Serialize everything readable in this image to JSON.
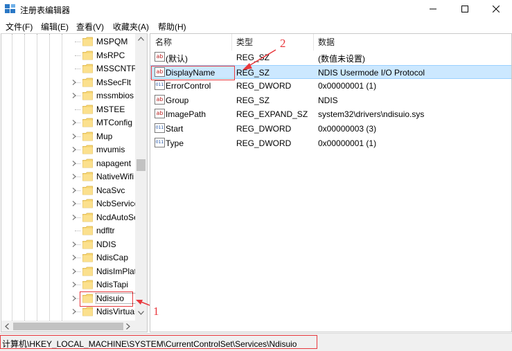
{
  "window": {
    "title": "注册表编辑器",
    "minimize_icon": "minimize-icon",
    "maximize_icon": "maximize-icon",
    "close_icon": "close-icon"
  },
  "menu": [
    "文件(F)",
    "编辑(E)",
    "查看(V)",
    "收藏夹(A)",
    "帮助(H)"
  ],
  "tree": {
    "items": [
      {
        "label": "MSPQM",
        "expandable": false
      },
      {
        "label": "MsRPC",
        "expandable": false
      },
      {
        "label": "MSSCNTRS",
        "expandable": false
      },
      {
        "label": "MsSecFlt",
        "expandable": true
      },
      {
        "label": "mssmbios",
        "expandable": true
      },
      {
        "label": "MSTEE",
        "expandable": false
      },
      {
        "label": "MTConfig",
        "expandable": true
      },
      {
        "label": "Mup",
        "expandable": true
      },
      {
        "label": "mvumis",
        "expandable": true
      },
      {
        "label": "napagent",
        "expandable": true
      },
      {
        "label": "NativeWifi",
        "expandable": true
      },
      {
        "label": "NcaSvc",
        "expandable": true
      },
      {
        "label": "NcbService",
        "expandable": true
      },
      {
        "label": "NcdAutoSetup",
        "expandable": true
      },
      {
        "label": "ndfltr",
        "expandable": false
      },
      {
        "label": "NDIS",
        "expandable": true
      },
      {
        "label": "NdisCap",
        "expandable": true
      },
      {
        "label": "NdisImPlatform",
        "expandable": true
      },
      {
        "label": "NdisTapi",
        "expandable": true
      },
      {
        "label": "Ndisuio",
        "expandable": true,
        "selected": true
      },
      {
        "label": "NdisVirtualBus",
        "expandable": true
      }
    ]
  },
  "list": {
    "columns": [
      "名称",
      "类型",
      "数据"
    ],
    "rows": [
      {
        "name": "(默认)",
        "type": "REG_SZ",
        "data": "(数值未设置)",
        "icon": "ab"
      },
      {
        "name": "DisplayName",
        "type": "REG_SZ",
        "data": "NDIS Usermode I/O Protocol",
        "icon": "ab",
        "selected": true
      },
      {
        "name": "ErrorControl",
        "type": "REG_DWORD",
        "data": "0x00000001 (1)",
        "icon": "dword"
      },
      {
        "name": "Group",
        "type": "REG_SZ",
        "data": "NDIS",
        "icon": "ab"
      },
      {
        "name": "ImagePath",
        "type": "REG_EXPAND_SZ",
        "data": "system32\\drivers\\ndisuio.sys",
        "icon": "ab"
      },
      {
        "name": "Start",
        "type": "REG_DWORD",
        "data": "0x00000003 (3)",
        "icon": "dword"
      },
      {
        "name": "Type",
        "type": "REG_DWORD",
        "data": "0x00000001 (1)",
        "icon": "dword"
      }
    ]
  },
  "status": {
    "path": "计算机\\HKEY_LOCAL_MACHINE\\SYSTEM\\CurrentControlSet\\Services\\Ndisuio"
  },
  "annotations": {
    "label_1": "1",
    "label_2": "2",
    "color": "#e8383d"
  },
  "colors": {
    "selection_bg": "#cce8ff",
    "folder": "#f8d775",
    "highlight": "#e8383d"
  }
}
